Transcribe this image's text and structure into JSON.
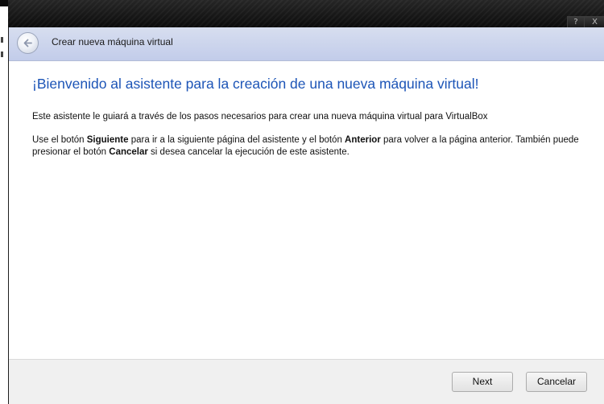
{
  "titlebar": {
    "help_label": "?",
    "close_label": "X"
  },
  "header": {
    "title": "Crear nueva máquina virtual",
    "back_icon": "back-arrow-icon"
  },
  "content": {
    "heading": "¡Bienvenido al asistente para la creación de una nueva máquina virtual!",
    "paragraph1": "Este asistente le guiará a través de los pasos necesarios para crear una nueva máquina virtual para VirtualBox",
    "paragraph2": {
      "part1": "Use el botón ",
      "bold1": "Siguiente",
      "part2": " para ir a la siguiente página del asistente y el botón ",
      "bold2": "Anterior",
      "part3": " para volver a la página anterior. También puede presionar el botón ",
      "bold3": "Cancelar",
      "part4": " si desea cancelar la ejecución de este asistente."
    }
  },
  "footer": {
    "next_label": "Next",
    "cancel_label": "Cancelar"
  },
  "colors": {
    "heading": "#1d55b7",
    "header_band": "#c8d1ec",
    "titlebar": "#1a1a1a"
  }
}
